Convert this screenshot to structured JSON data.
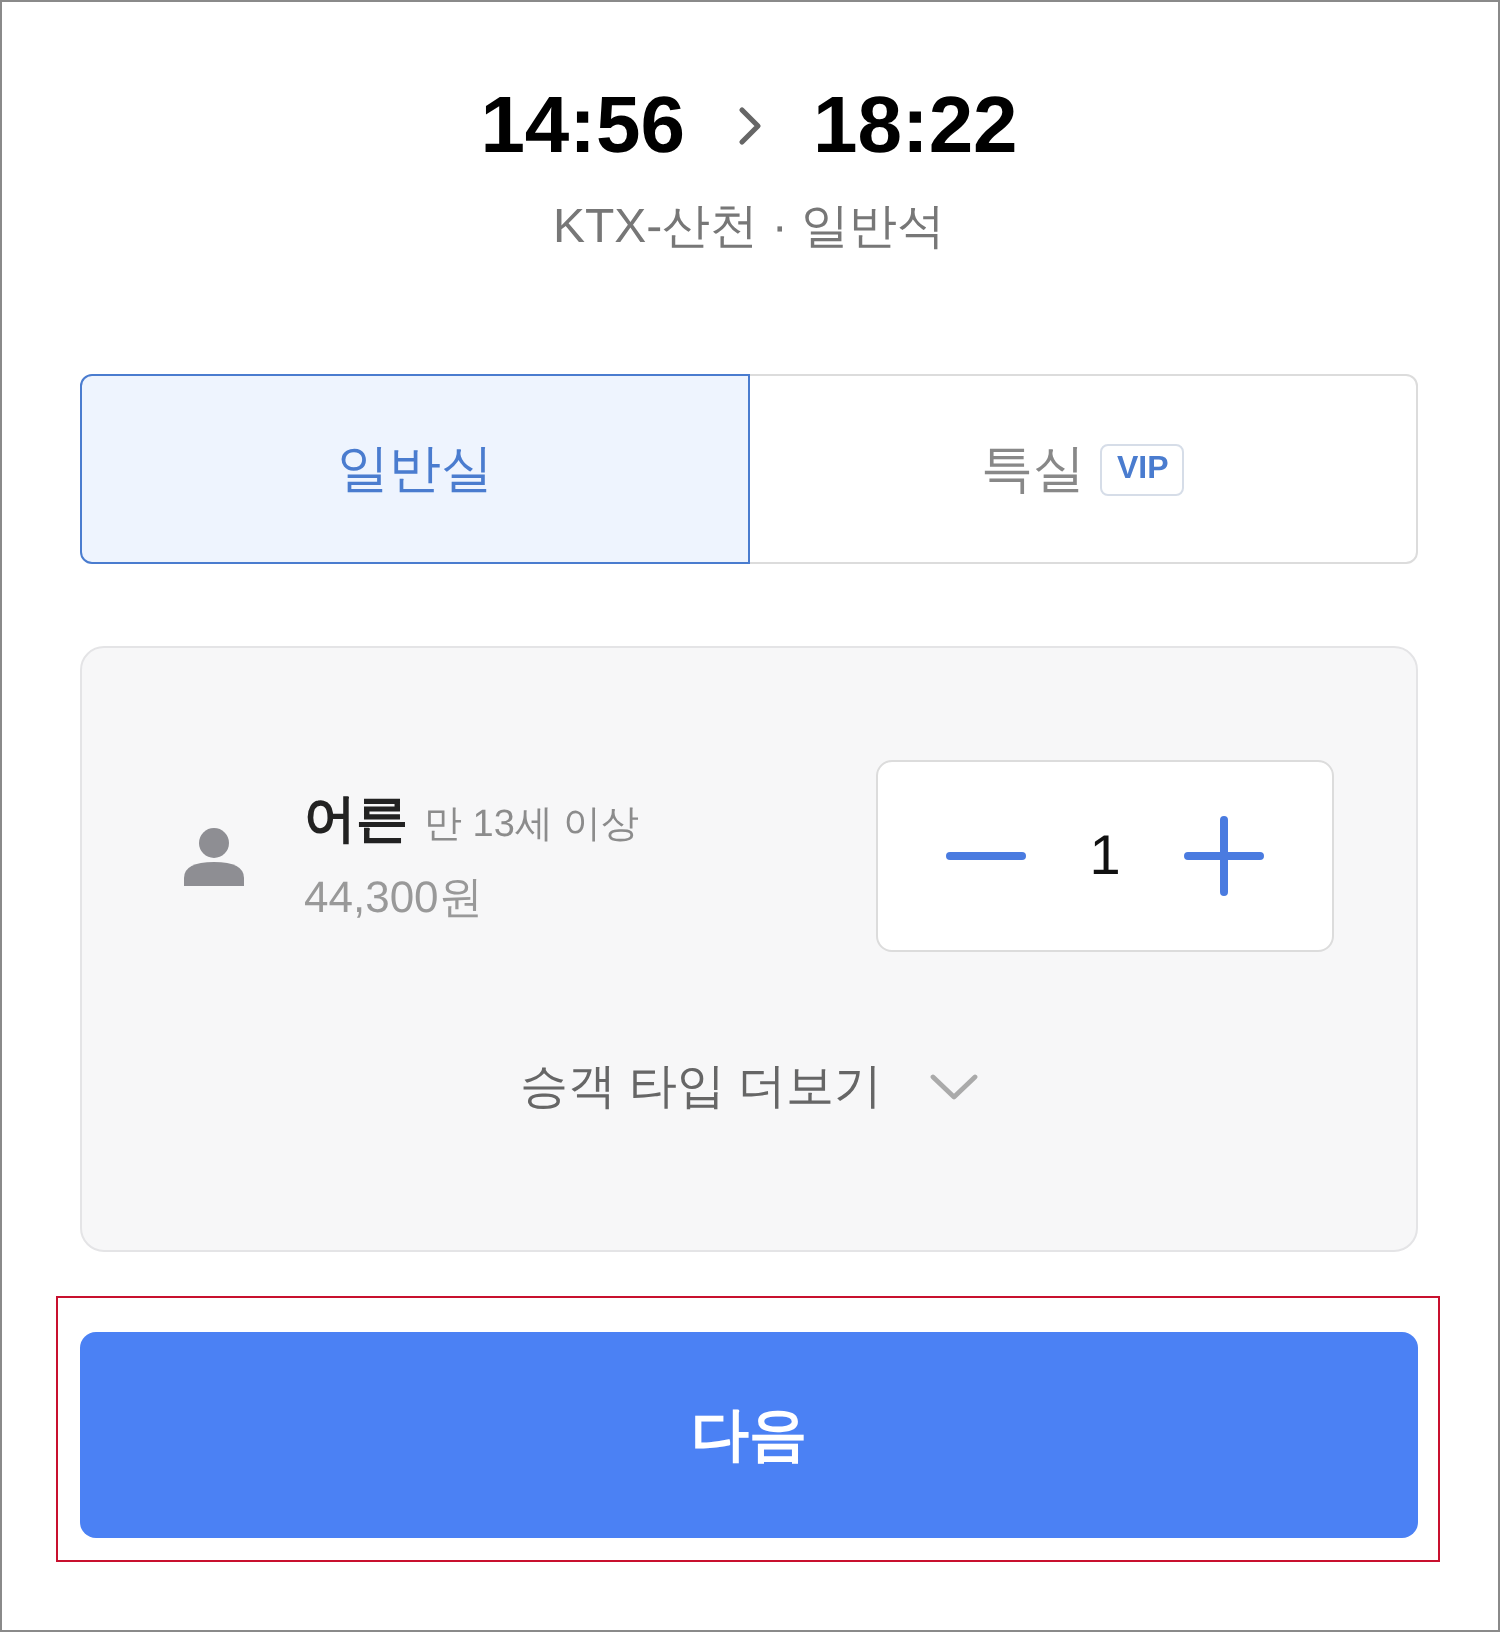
{
  "trip": {
    "departure_time": "14:56",
    "arrival_time": "18:22",
    "train_info": "KTX-산천 · 일반석"
  },
  "seat_classes": [
    {
      "label": "일반실",
      "selected": true
    },
    {
      "label": "특실",
      "badge": "VIP",
      "selected": false
    }
  ],
  "passenger": {
    "name": "어른",
    "age_note": "만 13세 이상",
    "price": "44,300원",
    "count": "1"
  },
  "more_passenger_types": {
    "label": "승객 타입 더보기"
  },
  "next_button": {
    "label": "다음",
    "highlighted": true
  }
}
